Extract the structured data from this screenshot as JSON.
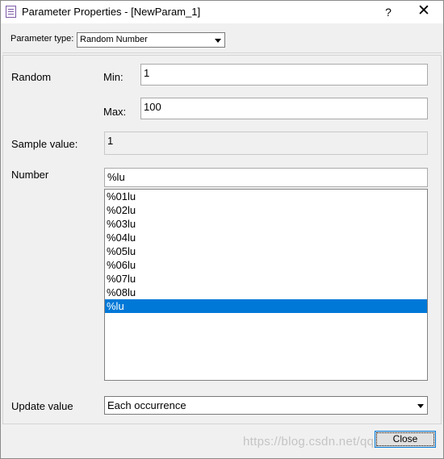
{
  "window": {
    "title": "Parameter Properties - [NewParam_1]",
    "help_glyph": "?",
    "close_glyph": "✕"
  },
  "parameter_type": {
    "label": "Parameter type:",
    "value": "Random Number"
  },
  "random": {
    "label": "Random",
    "min_label": "Min:",
    "min_value": "1",
    "max_label": "Max:",
    "max_value": "100"
  },
  "sample": {
    "label": "Sample value:",
    "value": "1"
  },
  "number": {
    "label": "Number",
    "format_value": "%lu",
    "formats": [
      "%01lu",
      "%02lu",
      "%03lu",
      "%04lu",
      "%05lu",
      "%06lu",
      "%07lu",
      "%08lu",
      "%lu"
    ],
    "selected_format": "%lu"
  },
  "update": {
    "label": "Update value",
    "value": "Each occurrence"
  },
  "buttons": {
    "close_label": "Close"
  },
  "watermark": "https://blog.csdn.net/qq_..."
}
